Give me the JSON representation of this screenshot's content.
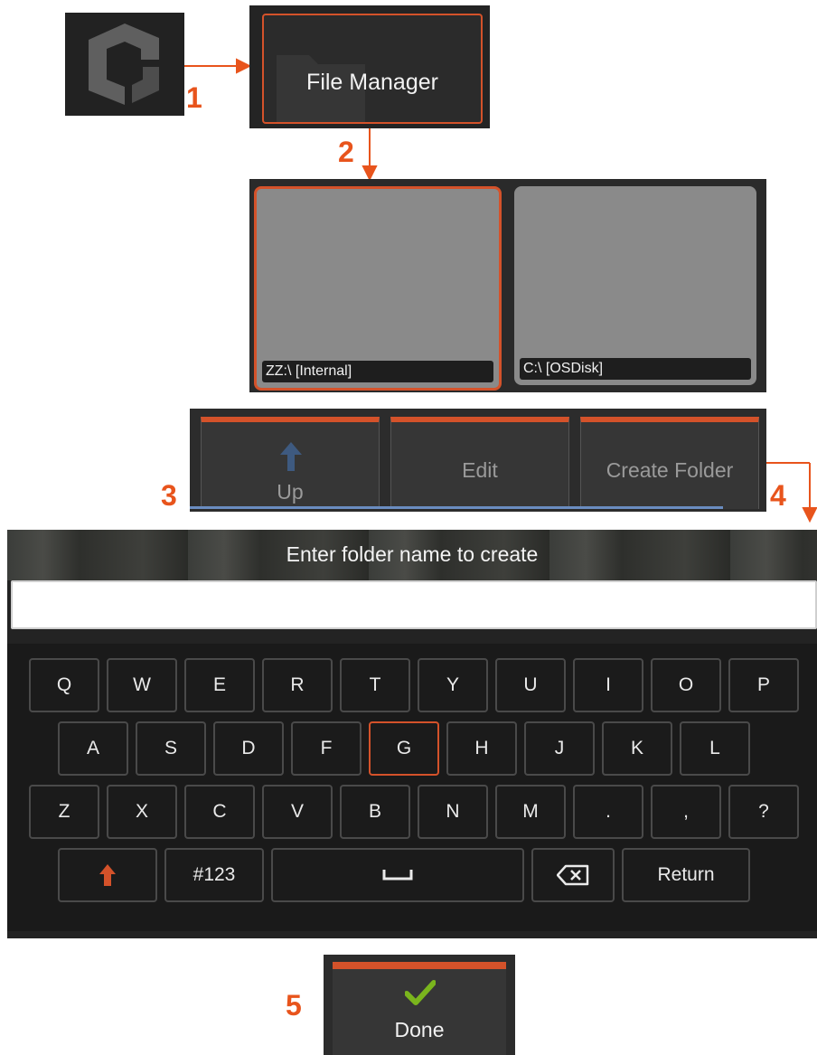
{
  "steps": {
    "s1": "1",
    "s2": "2",
    "s3": "3",
    "s4": "4",
    "s5": "5"
  },
  "file_manager": {
    "label": "File Manager"
  },
  "drives": [
    {
      "label": "ZZ:\\ [Internal]"
    },
    {
      "label": "C:\\ [OSDisk]"
    }
  ],
  "toolbar": {
    "up": "Up",
    "edit": "Edit",
    "create_folder": "Create Folder"
  },
  "dialog": {
    "prompt": "Enter folder name to create",
    "input_value": ""
  },
  "keyboard": {
    "row1": [
      "Q",
      "W",
      "E",
      "R",
      "T",
      "Y",
      "U",
      "I",
      "O",
      "P"
    ],
    "row2": [
      "A",
      "S",
      "D",
      "F",
      "G",
      "H",
      "J",
      "K",
      "L"
    ],
    "row3": [
      "Z",
      "X",
      "C",
      "V",
      "B",
      "N",
      "M",
      ".",
      ",",
      "?"
    ],
    "numbers_key": "#123",
    "return_key": "Return",
    "highlighted_key": "G"
  },
  "done": {
    "label": "Done"
  },
  "colors": {
    "accent": "#d4522a",
    "step_number": "#e8541c",
    "check": "#7ab51d",
    "up_arrow": "#3e5a80"
  },
  "icons": [
    "app-logo-icon",
    "folder-icon",
    "arrow-up-icon",
    "shift-icon",
    "space-icon",
    "backspace-icon",
    "checkmark-icon"
  ]
}
